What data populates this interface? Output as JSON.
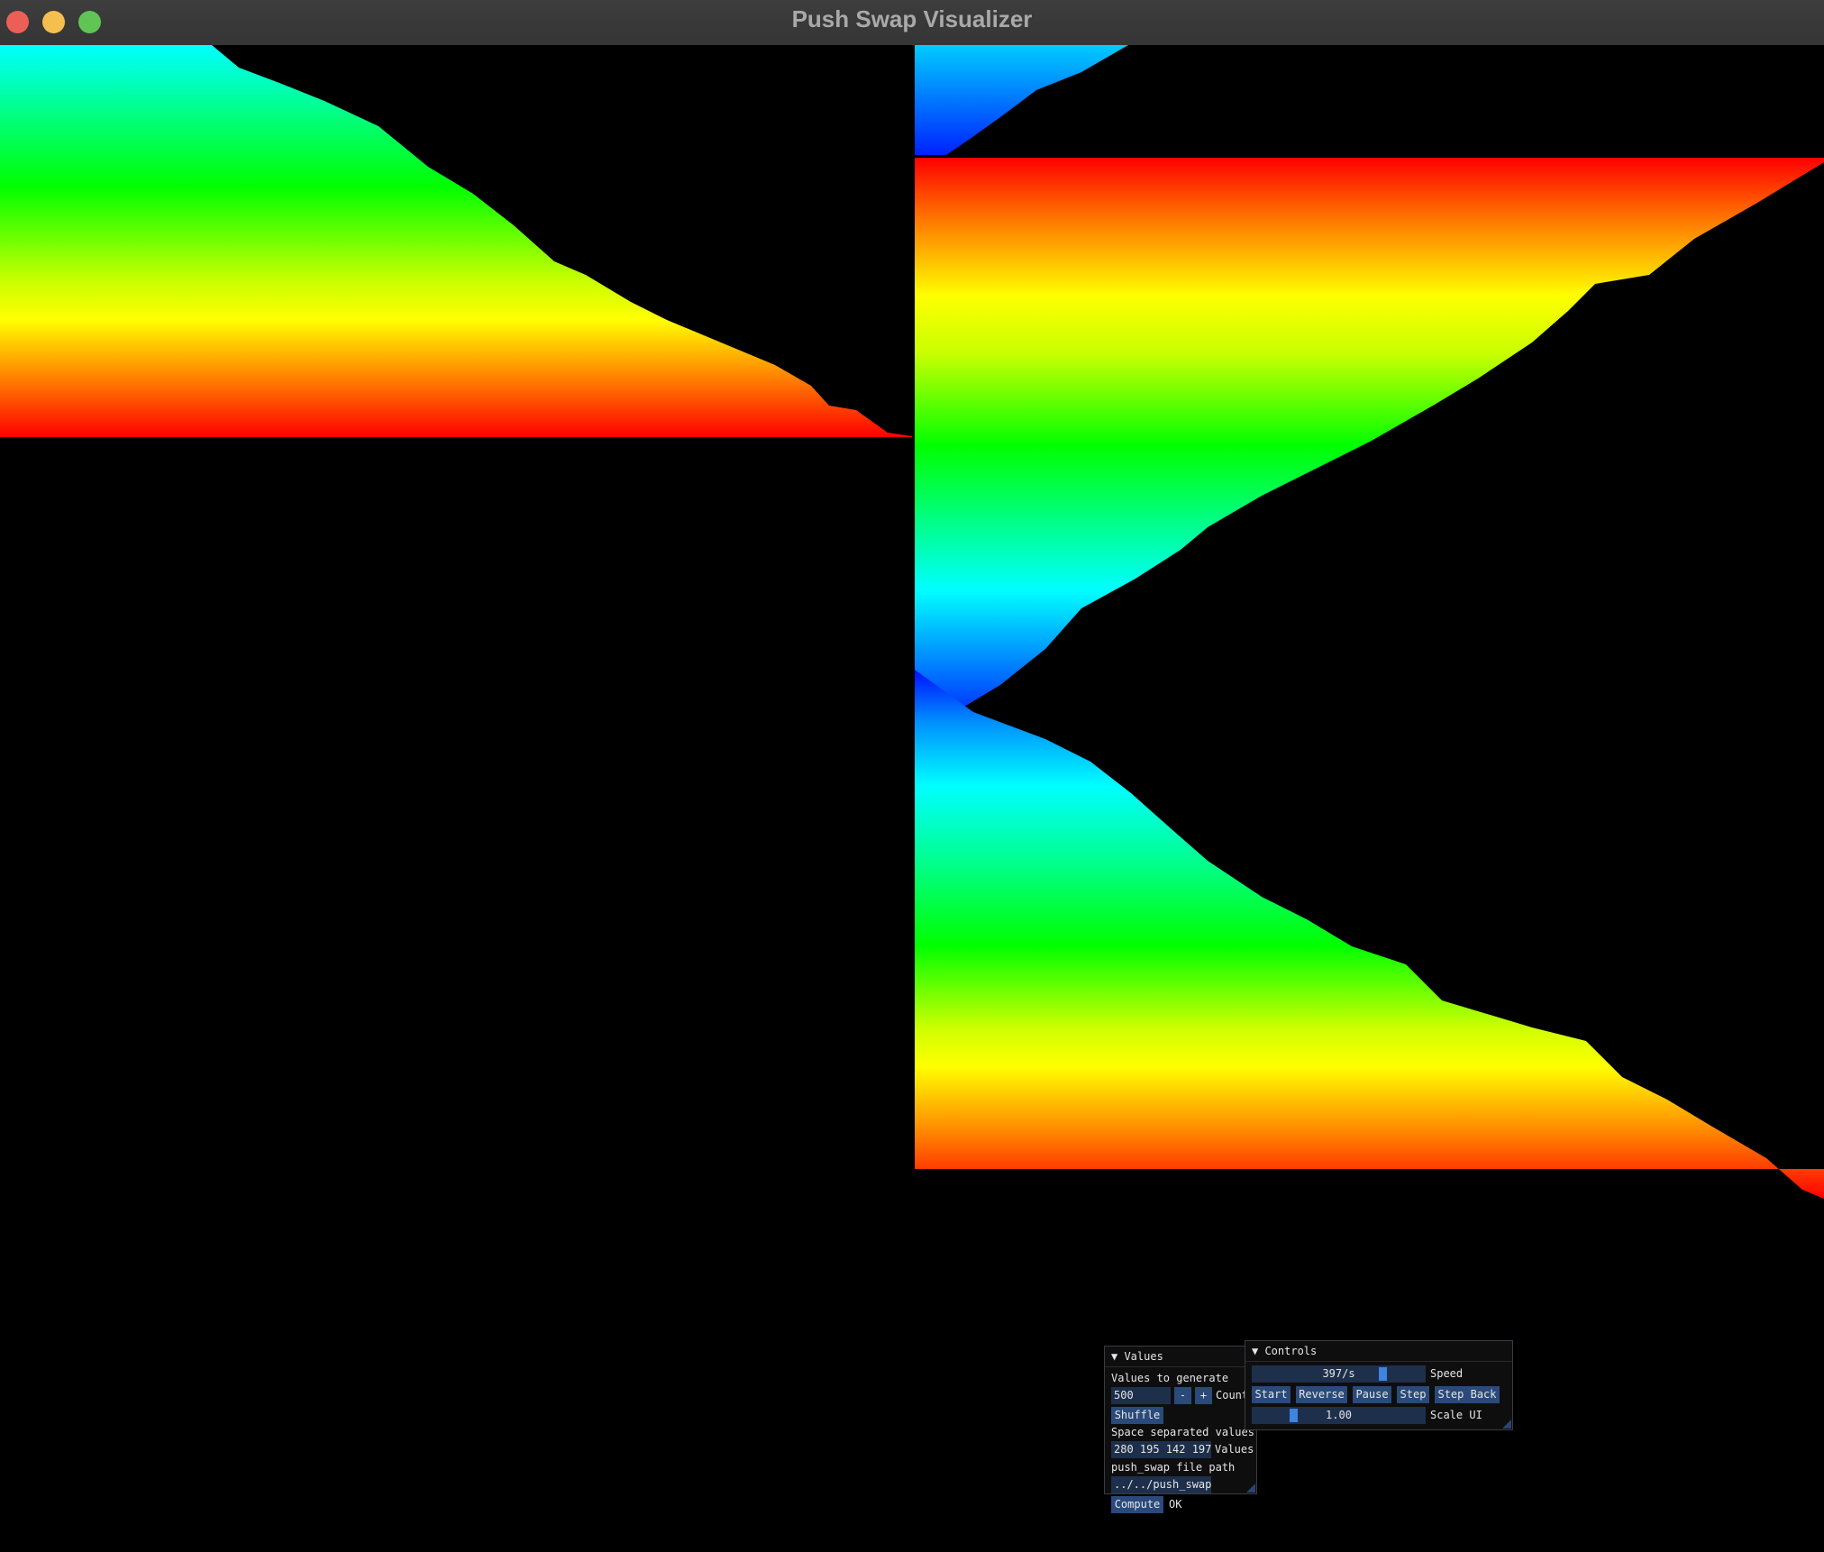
{
  "window": {
    "title": "Push Swap Visualizer"
  },
  "values_panel": {
    "title": "▼ Values",
    "values_to_generate_label": "Values to generate",
    "count_value": "500",
    "minus_label": "-",
    "plus_label": "+",
    "count_label": "Count",
    "shuffle_label": "Shuffle",
    "space_separated_label": "Space separated values",
    "values_input": "280 195 142 197",
    "values_label": "Values",
    "file_path_label": "push_swap file path",
    "file_path_value": "../../push_swap",
    "compute_label": "Compute",
    "status": "OK"
  },
  "controls_panel": {
    "title": "▼ Controls",
    "speed_value": "397/s",
    "speed_label": "Speed",
    "speed_fraction": 0.77,
    "start_label": "Start",
    "reverse_label": "Reverse",
    "pause_label": "Pause",
    "step_label": "Step",
    "step_back_label": "Step Back",
    "scale_value": "1.00",
    "scale_label": "Scale UI",
    "scale_fraction": 0.22
  },
  "colors": {
    "background": "#000000",
    "accent": "#3d85e0",
    "button": "#294a7a",
    "field": "#1d2f4b"
  }
}
